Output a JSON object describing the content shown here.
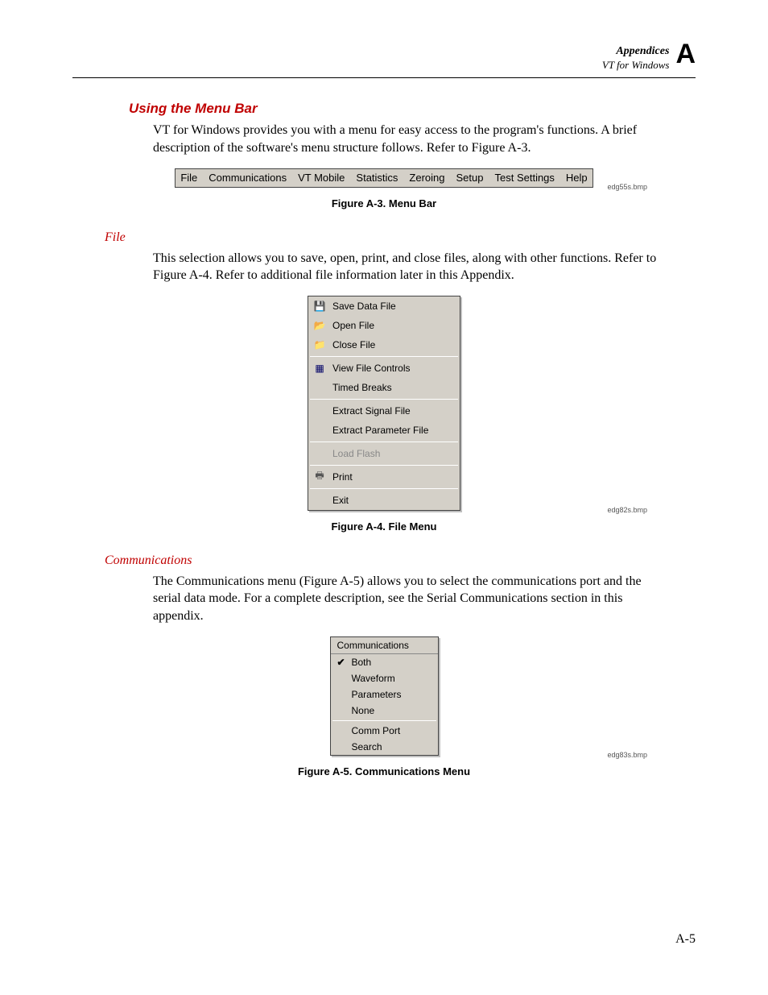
{
  "header": {
    "title": "Appendices",
    "subtitle": "VT for Windows",
    "letter": "A"
  },
  "section1": {
    "title": "Using the Menu Bar",
    "body": "VT for Windows provides you with a menu for easy access to the program's functions. A brief description of the software's menu structure follows. Refer to Figure A-3."
  },
  "figure_a3": {
    "menubar_items": [
      "File",
      "Communications",
      "VT Mobile",
      "Statistics",
      "Zeroing",
      "Setup",
      "Test Settings",
      "Help"
    ],
    "caption": "Figure A-3. Menu Bar",
    "bmp": "edg55s.bmp"
  },
  "file_section": {
    "title": "File",
    "body": "This selection allows you to save, open, print, and close files, along with other functions. Refer to Figure A-4. Refer to additional file information later in this Appendix."
  },
  "figure_a4": {
    "items_group1": [
      {
        "icon": "save-icon",
        "label": "Save Data File"
      },
      {
        "icon": "open-icon",
        "label": "Open File"
      },
      {
        "icon": "close-icon",
        "label": "Close File"
      }
    ],
    "items_group2": [
      {
        "icon": "view-icon",
        "label": "View File Controls"
      },
      {
        "icon": "",
        "label": "Timed Breaks"
      }
    ],
    "items_group3": [
      {
        "icon": "",
        "label": "Extract Signal File"
      },
      {
        "icon": "",
        "label": "Extract Parameter File"
      }
    ],
    "items_group4": [
      {
        "icon": "",
        "label": "Load Flash",
        "disabled": true
      }
    ],
    "items_group5": [
      {
        "icon": "print-icon",
        "label": "Print"
      }
    ],
    "items_group6": [
      {
        "icon": "",
        "label": "Exit"
      }
    ],
    "caption": "Figure A-4. File Menu",
    "bmp": "edg82s.bmp"
  },
  "comm_section": {
    "title": "Communications",
    "body": "The Communications menu (Figure A-5) allows you to select the communications port and the serial data mode. For a complete description, see the Serial Communications section in this appendix."
  },
  "figure_a5": {
    "head": "Communications",
    "group1": [
      {
        "checked": true,
        "label": "Both"
      },
      {
        "checked": false,
        "label": "Waveform"
      },
      {
        "checked": false,
        "label": "Parameters"
      },
      {
        "checked": false,
        "label": "None"
      }
    ],
    "group2": [
      {
        "label": "Comm Port"
      },
      {
        "label": "Search"
      }
    ],
    "caption": "Figure A-5. Communications Menu",
    "bmp": "edg83s.bmp"
  },
  "page_number": "A-5"
}
